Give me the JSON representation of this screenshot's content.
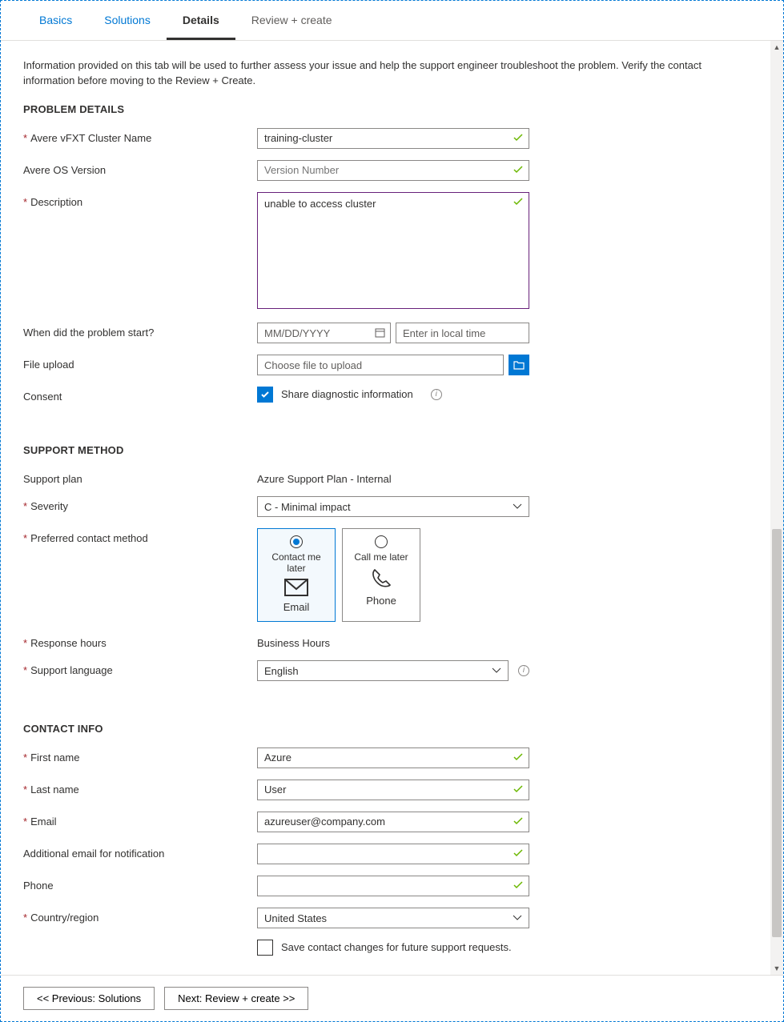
{
  "tabs": {
    "basics": "Basics",
    "solutions": "Solutions",
    "details": "Details",
    "review": "Review + create"
  },
  "intro": "Information provided on this tab will be used to further assess your issue and help the support engineer troubleshoot the problem. Verify the contact information before moving to the Review + Create.",
  "sections": {
    "problem": "PROBLEM DETAILS",
    "support": "SUPPORT METHOD",
    "contact": "CONTACT INFO"
  },
  "labels": {
    "cluster_name": "Avere vFXT Cluster Name",
    "os_version": "Avere OS Version",
    "description": "Description",
    "when_start": "When did the problem start?",
    "file_upload": "File upload",
    "consent": "Consent",
    "support_plan": "Support plan",
    "severity": "Severity",
    "contact_method": "Preferred contact method",
    "response_hours": "Response hours",
    "support_language": "Support language",
    "first_name": "First name",
    "last_name": "Last name",
    "email": "Email",
    "additional_email": "Additional email for notification",
    "phone": "Phone",
    "country": "Country/region"
  },
  "values": {
    "cluster_name": "training-cluster",
    "os_version_placeholder": "Version Number",
    "description": "unable to access cluster",
    "date_placeholder": "MM/DD/YYYY",
    "time_placeholder": "Enter in local time",
    "file_placeholder": "Choose file to upload",
    "consent_label": "Share diagnostic information",
    "support_plan": "Azure Support Plan - Internal",
    "severity": "C - Minimal impact",
    "response_hours": "Business Hours",
    "support_language": "English",
    "first_name": "Azure",
    "last_name": "User",
    "email": "azureuser@company.com",
    "additional_email": "",
    "phone": "",
    "country": "United States",
    "save_contact": "Save contact changes for future support requests."
  },
  "cards": {
    "email_top": "Contact me later",
    "email_sub": "Email",
    "phone_top": "Call me later",
    "phone_sub": "Phone"
  },
  "footer": {
    "prev": "<< Previous: Solutions",
    "next": "Next: Review + create >>"
  }
}
